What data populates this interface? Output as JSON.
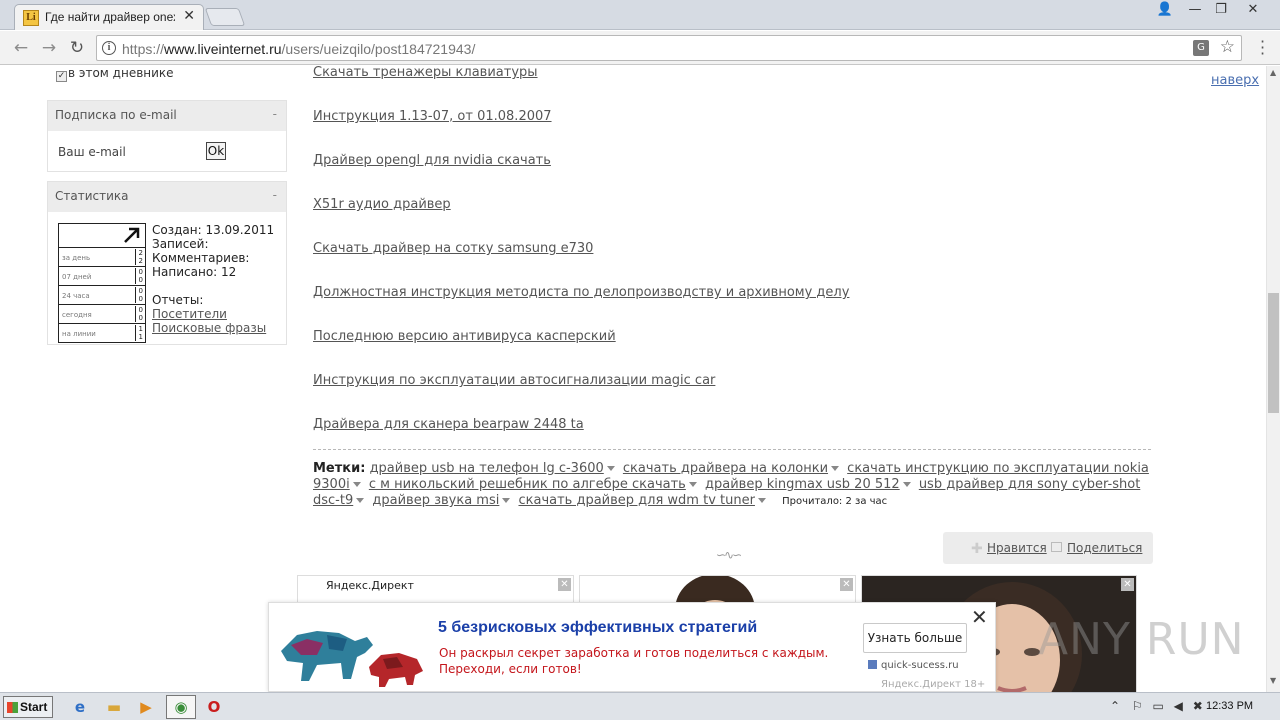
{
  "browser": {
    "tab_title": "Где найти драйвер onext",
    "url_scheme": "https://",
    "url_host": "www.liveinternet.ru",
    "url_path": "/users/ueizqilo/post184721943/",
    "translate_icon": "translate-icon",
    "bookmark_icon": "star-icon"
  },
  "sidebar": {
    "checkbox_label": "в этом дневнике",
    "subscribe": {
      "title": "Подписка по e-mail",
      "collapse": "-",
      "email_label": "Ваш e-mail",
      "ok_label": "Ok"
    },
    "stats": {
      "title": "Статистика",
      "collapse": "-",
      "rows": [
        {
          "label": "за день",
          "top": "2",
          "bottom": "2"
        },
        {
          "label": "07 дней",
          "top": "0",
          "bottom": "0"
        },
        {
          "label": "24 часа",
          "top": "0",
          "bottom": "0"
        },
        {
          "label": "сегодня",
          "top": "0",
          "bottom": "0"
        },
        {
          "label": "на линии",
          "top": "1",
          "bottom": "1"
        }
      ],
      "created": "Создан: 13.09.2011",
      "records": "Записей:",
      "comments": "Комментариев:",
      "written": "Написано: 12",
      "reports": "Отчеты:",
      "visitors": "Посетители",
      "phrases": "Поисковые фразы"
    }
  },
  "content": {
    "links": [
      "Скачать тренажеры клавиатуры",
      "Инструкция 1.13-07, от 01.08.2007",
      "Драйвер opengl для nvidia скачать",
      "X51r аудио драйвер",
      "Скачать драйвер на сотку samsung e730",
      "Должностная инструкция методиста по делопроизводству и архивному делу",
      "Последнюю версию антивируса касперский",
      "Инструкция по эксплуатации автосигнализации magic car",
      "Драйвера для сканера bearpaw 2448 ta"
    ],
    "tags_label": "Метки:",
    "tags": [
      "драйвер usb на телефон lg c-3600",
      "скачать драйвера на колонки",
      "скачать инструкцию по эксплуатации nokia 9300i",
      "с м никольский решебник по алгебре скачать",
      "драйвер kingmax usb 20 512",
      "usb драйвер для sony cyber-shot dsc-t9",
      "драйвер звука msi",
      "скачать драйвер для wdm tv tuner"
    ],
    "read_count": "Прочитало: 2 за час",
    "like_label": "Нравится",
    "share_label": "Поделиться",
    "to_top": "наверх"
  },
  "ads": {
    "tile_label": "Яндекс.Директ",
    "popup": {
      "title": "5 безрисковых эффективных стратегий",
      "line1": "Он раскрыл секрет заработка и готов поделиться с каждым.",
      "line2": "Переходи, если готов!",
      "button": "Узнать больше",
      "domain": "quick-sucess.ru",
      "footer": "Яндекс.Директ 18+"
    }
  },
  "watermark": "ANY RUN",
  "taskbar": {
    "start_label": "Start",
    "clock": "12:33 PM"
  },
  "colors": {
    "popup_title": "#1a3fa8",
    "popup_text": "#c4161c",
    "link": "#555555"
  }
}
